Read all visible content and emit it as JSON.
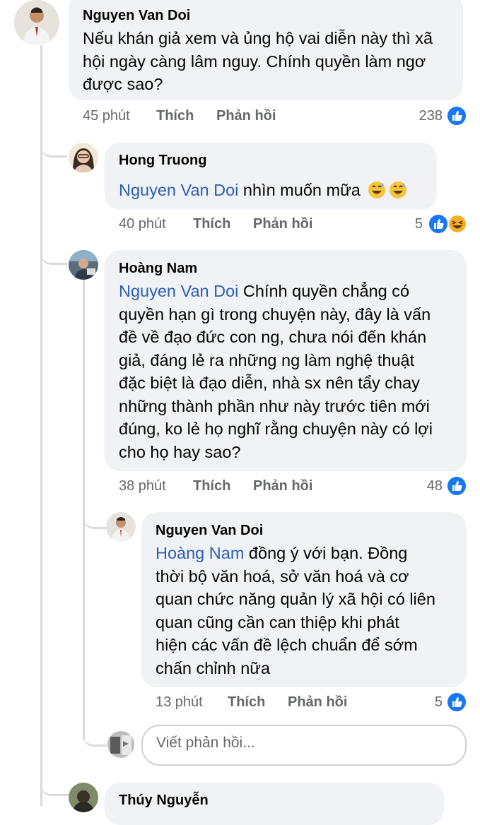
{
  "comments": [
    {
      "author": "Nguyen Van Doi",
      "text": "Nếu khán giả xem và ủng hộ vai diễn này thì xã hội ngày càng lâm nguy. Chính quyền làm ngơ được sao?",
      "lines": [
        "Nếu khán giả xem và ủng hộ vai diễn này thì xã",
        "hội ngày càng lâm nguy. Chính quyền làm ngơ",
        "được sao?"
      ],
      "time": "45 phút",
      "like_label": "Thích",
      "reply_label": "Phản hồi",
      "reaction_count": "238"
    },
    {
      "author": "Hong Truong",
      "mention": "Nguyen Van Doi",
      "text": " nhìn muốn mữa",
      "time": "40 phút",
      "like_label": "Thích",
      "reply_label": "Phản hồi",
      "reaction_count": "5"
    },
    {
      "author": "Hoàng Nam",
      "mention": "Nguyen Van Doi",
      "lines": [
        " Chính quyền chẳng có",
        "quyền hạn gì trong chuyện này, đây là vấn",
        "đề về đạo đức con ng, chưa nói đến khán",
        "giả, đáng lẻ ra những ng làm nghệ thuật",
        "đặc biệt là đạo diễn, nhà sx nên tẩy chay",
        "những thành phần như này trước tiên mới",
        "đúng, ko lẻ họ nghĩ rằng chuyện này có lợi",
        "cho họ hay sao?"
      ],
      "time": "38 phút",
      "like_label": "Thích",
      "reply_label": "Phản hồi",
      "reaction_count": "48"
    },
    {
      "author": "Nguyen Van Doi",
      "mention": "Hoàng Nam",
      "lines": [
        " đồng ý với bạn. Đồng",
        "thời bộ văn hoá, sở văn hoá và cơ",
        "quan chức năng quản lý xã hội có liên",
        "quan cũng cần can thiệp khi phát",
        "hiện các vấn đề lệch chuẩn để sớm",
        "chấn chỉnh nữa"
      ],
      "time": "13 phút",
      "like_label": "Thích",
      "reply_label": "Phản hồi",
      "reaction_count": "5"
    }
  ],
  "reply_box": {
    "placeholder": "Viết phản hồi..."
  },
  "next_comment": {
    "author": "Thúy Nguyễn"
  },
  "colors": {
    "bubble": "#f0f2f5",
    "mention": "#2c5fb3",
    "like_blue": "#1877f2",
    "meta_gray": "#65676b"
  },
  "icons": [
    "like-reaction-icon",
    "haha-reaction-icon",
    "grinning-sweat-emoji-icon"
  ]
}
